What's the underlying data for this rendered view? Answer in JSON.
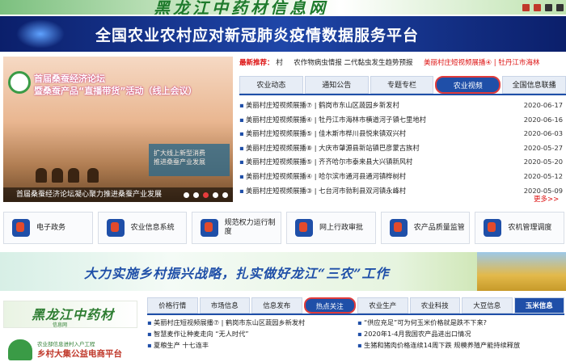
{
  "top_banner": {
    "title": "黑龙江中药材信息网"
  },
  "covid_banner": {
    "title": "全国农业农村应对新冠肺炎疫情数据服务平台"
  },
  "slider": {
    "headline_1": "首届桑蚕经济论坛",
    "headline_2": "暨桑蚕产品“直播带货”活动（线上会议）",
    "board_text_1": "扩大线上新型消费",
    "board_text_2": "推进桑蚕产业发展",
    "caption": "首届桑蚕经济论坛凝心聚力推进桑蚕产业发展",
    "active_dot": 3,
    "dot_count": 5
  },
  "ticker": {
    "label": "最新推荐：",
    "items": [
      "村",
      "农作物病虫情报 二代黏虫发生趋势预报"
    ],
    "highlight": "美丽村庄短视频展播④ | 牡丹江市海林"
  },
  "tabs": [
    {
      "label": "农业动态",
      "active": false
    },
    {
      "label": "通知公告",
      "active": false
    },
    {
      "label": "专题专栏",
      "active": false
    },
    {
      "label": "农业视频",
      "active": true
    },
    {
      "label": "全国信息联播",
      "active": false
    }
  ],
  "news": [
    {
      "title": "美丽村庄短视频展播⑦ | 鹤岗市东山区蔬园乡新发村",
      "date": "2020-06-17"
    },
    {
      "title": "美丽村庄短视频展播④ | 牡丹江市海林市横道河子镇七里地村",
      "date": "2020-06-16"
    },
    {
      "title": "美丽村庄短视频展播⑤ | 佳木斯市桦川县悦来镇双兴村",
      "date": "2020-06-03"
    },
    {
      "title": "美丽村庄短视频展播⑧ | 大庆市肇源县新站镇巴彦蒙古族村",
      "date": "2020-05-27"
    },
    {
      "title": "美丽村庄短视频展播⑤ | 齐齐哈尔市泰来县大兴镇新风村",
      "date": "2020-05-20"
    },
    {
      "title": "美丽村庄短视频展播④ | 哈尔滨市通河县通河镇桦树村",
      "date": "2020-05-12"
    },
    {
      "title": "美丽村庄短视频展播③ | 七台河市勃利县双河镇永峰村",
      "date": "2020-05-09"
    }
  ],
  "more_label": "更多>>",
  "quick_links": [
    {
      "label": "电子政务",
      "icon": "government-icon"
    },
    {
      "label": "农业信息系统",
      "icon": "info-system-icon"
    },
    {
      "label": "规范权力运行制度",
      "icon": "regulation-icon"
    },
    {
      "label": "网上行政审批",
      "icon": "approval-icon"
    },
    {
      "label": "农产品质量监管",
      "icon": "quality-icon"
    },
    {
      "label": "农机管理调度",
      "icon": "tractor-icon"
    }
  ],
  "slogan": {
    "text": "大力实施乡村振兴战略，扎实做好龙江“三农”工作"
  },
  "bottom_left": {
    "logo_title": "黑龙江中药材",
    "logo_sub": "信息网",
    "promo_small": "农业部信息进村入户工程",
    "promo_big": "乡村大集公益电商平台"
  },
  "bottom_tabs": [
    {
      "label": "价格行情",
      "active": false
    },
    {
      "label": "市场信息",
      "active": false
    },
    {
      "label": "信息发布",
      "active": false
    },
    {
      "label": "热点关注",
      "active": true
    },
    {
      "label": "农业生产",
      "active": false
    },
    {
      "label": "农业科技",
      "active": false
    },
    {
      "label": "大豆信息",
      "active": false
    },
    {
      "label": "玉米信息",
      "active": false
    }
  ],
  "bottom_news": [
    {
      "title": "美丽村庄短视频展播⑦ | 鹤岗市东山区蔬园乡新发村"
    },
    {
      "title": "“供应充足”可为何玉米价格就是跌不下来?"
    },
    {
      "title": "智慧麦作让种麦走向 “无人时代”"
    },
    {
      "title": "2020年1-4月我国农产品进出口情况"
    },
    {
      "title": "夏粮生产 十七连丰"
    },
    {
      "title": "生猪和猪肉价格连续14周下跌 规模养殖产能持续释放"
    }
  ],
  "colors": {
    "primary_blue": "#1f4fa8",
    "accent_red": "#e03b3b",
    "green": "#2e7d32"
  }
}
